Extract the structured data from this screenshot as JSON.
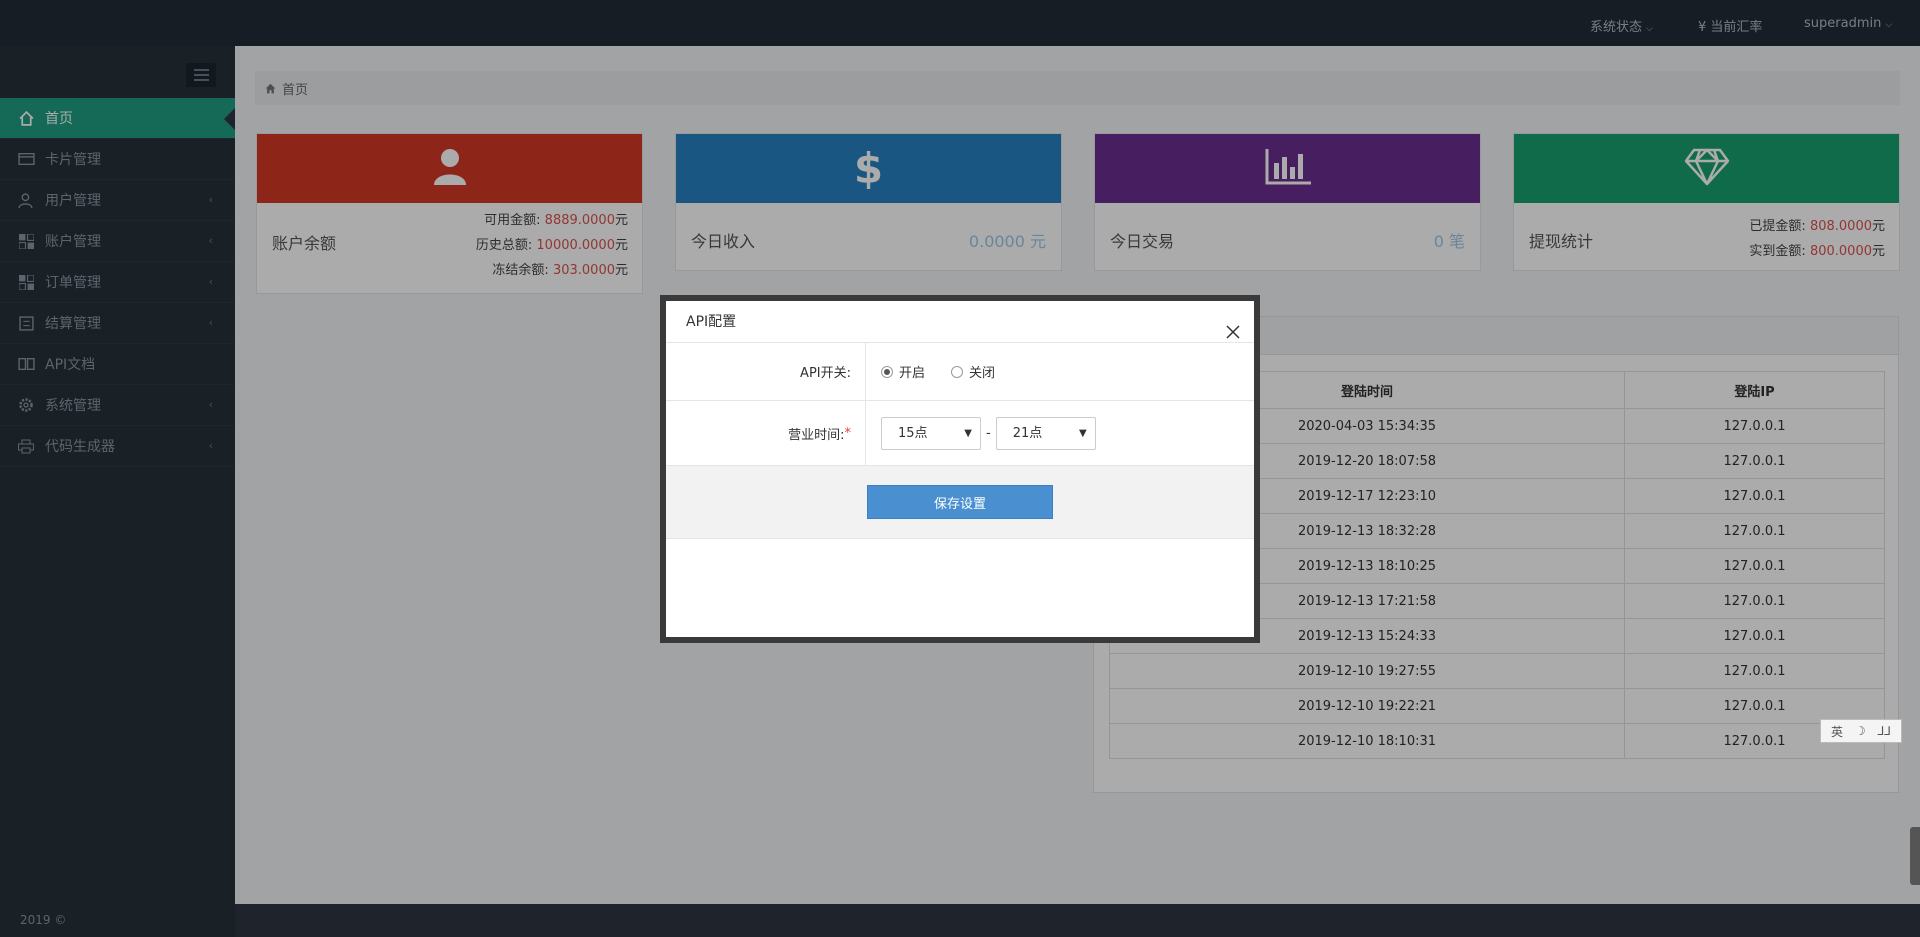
{
  "topbar": {
    "system_status": "系统状态",
    "current_rate": "当前汇率",
    "user": "superadmin"
  },
  "sidebar": {
    "items": [
      {
        "label": "首页",
        "icon": "home-icon",
        "active": true
      },
      {
        "label": "卡片管理",
        "icon": "card-icon"
      },
      {
        "label": "用户管理",
        "icon": "user-icon"
      },
      {
        "label": "账户管理",
        "icon": "account-icon"
      },
      {
        "label": "订单管理",
        "icon": "order-icon"
      },
      {
        "label": "结算管理",
        "icon": "settlement-icon"
      },
      {
        "label": "API文档",
        "icon": "doc-icon"
      },
      {
        "label": "系统管理",
        "icon": "gear-icon"
      },
      {
        "label": "代码生成器",
        "icon": "printer-icon"
      }
    ],
    "footer": "2019 ©"
  },
  "breadcrumb": {
    "home": "首页"
  },
  "cards": {
    "balance": {
      "title": "账户余额",
      "color": "#d33a24",
      "available_label": "可用金额:",
      "available_value": "8889.0000",
      "history_label": "历史总额:",
      "history_value": "10000.0000",
      "frozen_label": "冻结余额:",
      "frozen_value": "303.0000",
      "unit": "元"
    },
    "income": {
      "title": "今日收入",
      "value": "0.0000 元",
      "color": "#2680c2"
    },
    "trade": {
      "title": "今日交易",
      "value": "0 笔",
      "color": "#6b2e8f"
    },
    "withdraw": {
      "title": "提现统计",
      "color": "#17a06e",
      "withdrawn_label": "已提金额:",
      "withdrawn_value": "808.0000",
      "received_label": "实到金额:",
      "received_value": "800.0000",
      "unit": "元"
    }
  },
  "login_table": {
    "headers": [
      "登陆时间",
      "登陆IP"
    ],
    "rows": [
      [
        "2020-04-03 15:34:35",
        "127.0.0.1"
      ],
      [
        "2019-12-20 18:07:58",
        "127.0.0.1"
      ],
      [
        "2019-12-17 12:23:10",
        "127.0.0.1"
      ],
      [
        "2019-12-13 18:32:28",
        "127.0.0.1"
      ],
      [
        "2019-12-13 18:10:25",
        "127.0.0.1"
      ],
      [
        "2019-12-13 17:21:58",
        "127.0.0.1"
      ],
      [
        "2019-12-13 15:24:33",
        "127.0.0.1"
      ],
      [
        "2019-12-10 19:27:55",
        "127.0.0.1"
      ],
      [
        "2019-12-10 19:22:21",
        "127.0.0.1"
      ],
      [
        "2019-12-10 18:10:31",
        "127.0.0.1"
      ]
    ]
  },
  "modal": {
    "title": "API配置",
    "api_switch_label": "API开关:",
    "api_on": "开启",
    "api_off": "关闭",
    "hours_label": "营业时间:",
    "required_mark": "*",
    "start_hour": "15点",
    "end_hour": "21点",
    "separator": "-",
    "save": "保存设置"
  },
  "ime": {
    "lang": "英",
    "moon": "☽",
    "punct": "⅃⅃"
  }
}
